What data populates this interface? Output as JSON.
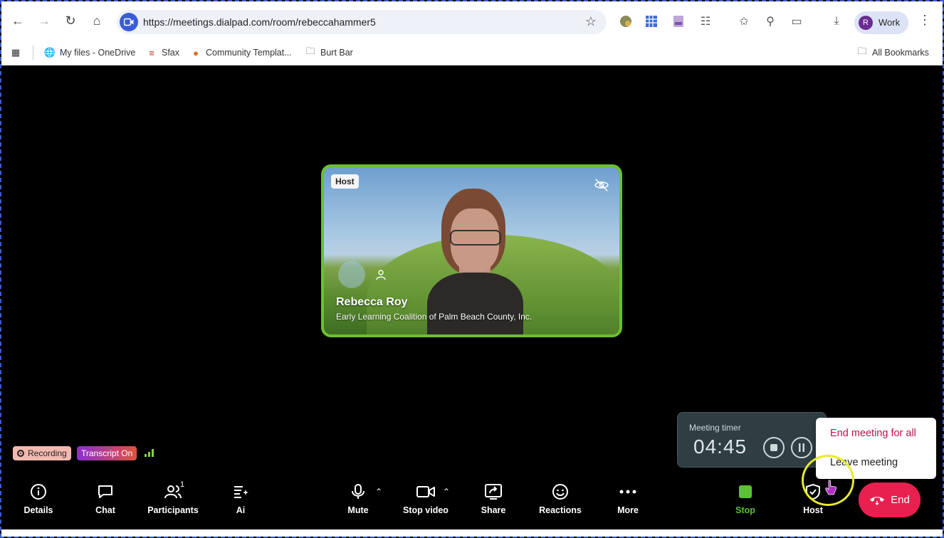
{
  "browser": {
    "url": "https://meetings.dialpad.com/room/rebeccahammer5",
    "profile": {
      "initial": "R",
      "label": "Work"
    },
    "bookmarks": [
      {
        "label": "My files - OneDrive",
        "icon": "globe-icon"
      },
      {
        "label": "Sfax",
        "icon": "sfax-icon"
      },
      {
        "label": "Community Templat...",
        "icon": "orange-circle-icon"
      },
      {
        "label": "Burt Bar",
        "icon": "folder-icon"
      }
    ],
    "all_bookmarks": "All Bookmarks"
  },
  "tile": {
    "badge": "Host",
    "name": "Rebecca Roy",
    "org": "Early Learning Coalition of Palm Beach County, Inc.",
    "border_color": "#6ac12e"
  },
  "status": {
    "recording": "Recording",
    "transcript": "Transcript On"
  },
  "timer": {
    "label": "Meeting timer",
    "value": "04:45"
  },
  "end_menu": {
    "end_all": "End meeting for all",
    "leave": "Leave meeting"
  },
  "toolbar": {
    "details": "Details",
    "chat": "Chat",
    "participants": "Participants",
    "participants_count": "1",
    "ai": "Ai",
    "mute": "Mute",
    "stop_video": "Stop video",
    "share": "Share",
    "reactions": "Reactions",
    "more": "More",
    "stop": "Stop",
    "host": "Host",
    "end": "End",
    "stop_color": "#5bc236",
    "end_color": "#e8204f"
  }
}
